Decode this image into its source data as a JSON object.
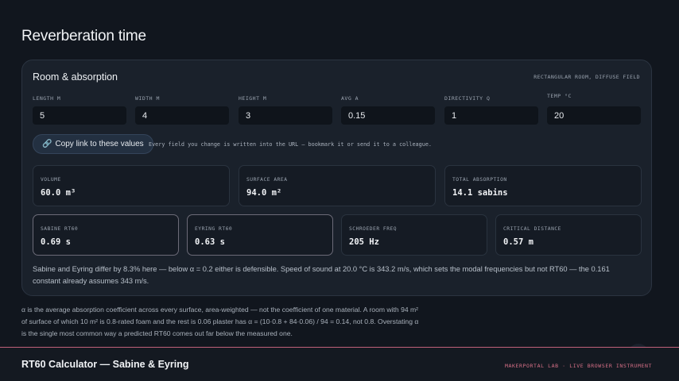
{
  "page": {
    "title": "Reverberation time"
  },
  "card": {
    "title": "Room & absorption",
    "tag": "RECTANGULAR ROOM, DIFFUSE FIELD",
    "fields": [
      {
        "label": "LENGTH M",
        "value": "5"
      },
      {
        "label": "WIDTH M",
        "value": "4"
      },
      {
        "label": "HEIGHT M",
        "value": "3"
      },
      {
        "label": "AVG Α",
        "value": "0.15"
      },
      {
        "label": "DIRECTIVITY Q",
        "value": "1"
      },
      {
        "label": "TEMP °C",
        "value": "20"
      }
    ],
    "copy_button": {
      "icon": "link-icon",
      "label": "Copy link to these values",
      "glyph": "🔗"
    },
    "copy_note": "Every field you change is written into the URL — bookmark it or send it to a colleague.",
    "stats_top": [
      {
        "label": "VOLUME",
        "value": "60.0 m³"
      },
      {
        "label": "SURFACE AREA",
        "value": "94.0 m²"
      },
      {
        "label": "TOTAL ABSORPTION",
        "value": "14.1 sabins"
      }
    ],
    "stats_bottom": [
      {
        "label": "SABINE RT60",
        "value": "0.69 s"
      },
      {
        "label": "EYRING RT60",
        "value": "0.63 s"
      },
      {
        "label": "SCHROEDER FREQ",
        "value": "205 Hz"
      },
      {
        "label": "CRITICAL DISTANCE",
        "value": "0.57 m"
      }
    ],
    "summary": "Sabine and Eyring differ by 8.3% here — below α = 0.2 either is defensible. Speed of sound at 20.0 °C is 343.2 m/s, which sets the modal frequencies but not RT60 — the 0.161 constant already assumes 343 m/s."
  },
  "explanation": "α is the average absorption coefficient across every surface, area-weighted — not the coefficient of one material. A room with 94 m² of surface of which 10 m² is 0.8-rated foam and the rest is 0.06 plaster has α = (10·0.8 + 84·0.06) / 94 = 0.14, not 0.8. Overstating α is the single most common way a predicted RT60 comes out far below the measured one.",
  "footer": {
    "title": "RT60 Calculator — Sabine & Eyring",
    "brand": "MAKERPORTAL LAB · LIVE BROWSER INSTRUMENT"
  },
  "colors": {
    "background": "#11161e",
    "card": "#1a212b",
    "accent": "#d56f86",
    "highlight_border": "#6c6b78"
  }
}
